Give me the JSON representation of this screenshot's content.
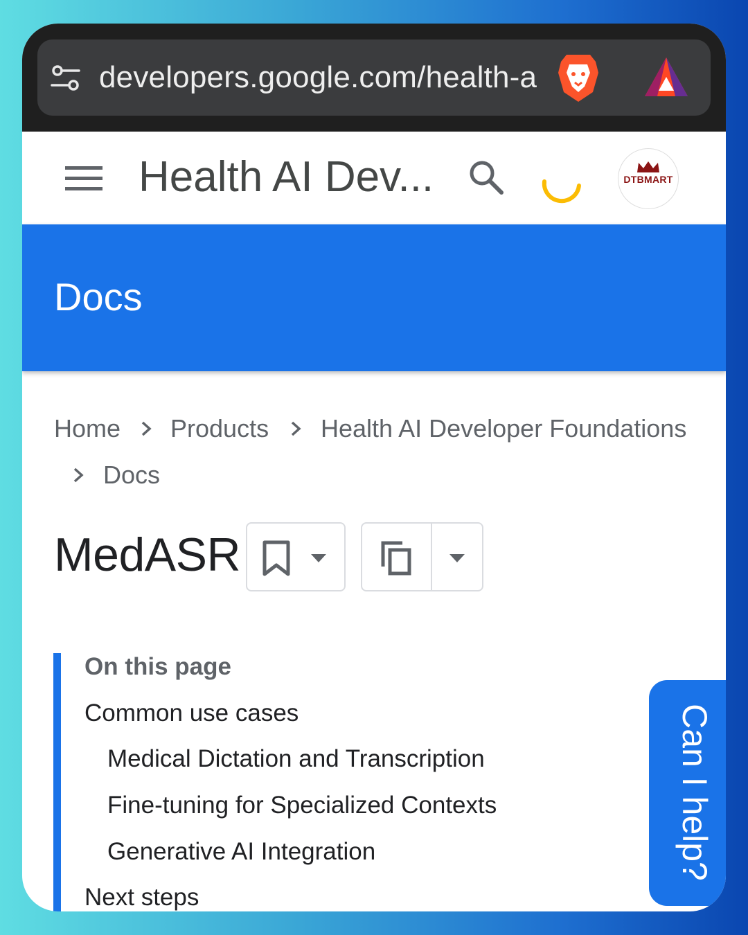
{
  "browser": {
    "url": "developers.google.com/health-a",
    "icons": [
      "site-settings-icon",
      "brave-lion-icon",
      "bat-rewards-icon"
    ]
  },
  "header": {
    "title": "Health AI Dev...",
    "avatar_label": "DTBMART",
    "icons": [
      "menu-icon",
      "search-icon",
      "loading-spinner-icon",
      "avatar"
    ]
  },
  "banner": {
    "title": "Docs"
  },
  "breadcrumb": {
    "items": [
      "Home",
      "Products",
      "Health AI Developer Foundations",
      "Docs"
    ]
  },
  "page": {
    "title": "MedASR",
    "icons": [
      "bookmark-icon",
      "caret-down-icon",
      "copy-icon",
      "caret-down-icon"
    ]
  },
  "toc": {
    "heading": "On this page",
    "items": [
      {
        "label": "Common use cases",
        "level": 1
      },
      {
        "label": "Medical Dictation and Transcription",
        "level": 2
      },
      {
        "label": "Fine-tuning for Specialized Contexts",
        "level": 2
      },
      {
        "label": "Generative AI Integration",
        "level": 2
      },
      {
        "label": "Next steps",
        "level": 1
      }
    ]
  },
  "help_tab": {
    "label": "Can I help?"
  },
  "colors": {
    "accent": "#1a73e8",
    "browser_bar": "#1f1f1f",
    "url_pill": "#3b3c3e",
    "spinner": "#fbbc04",
    "brave": "#fb542b"
  }
}
